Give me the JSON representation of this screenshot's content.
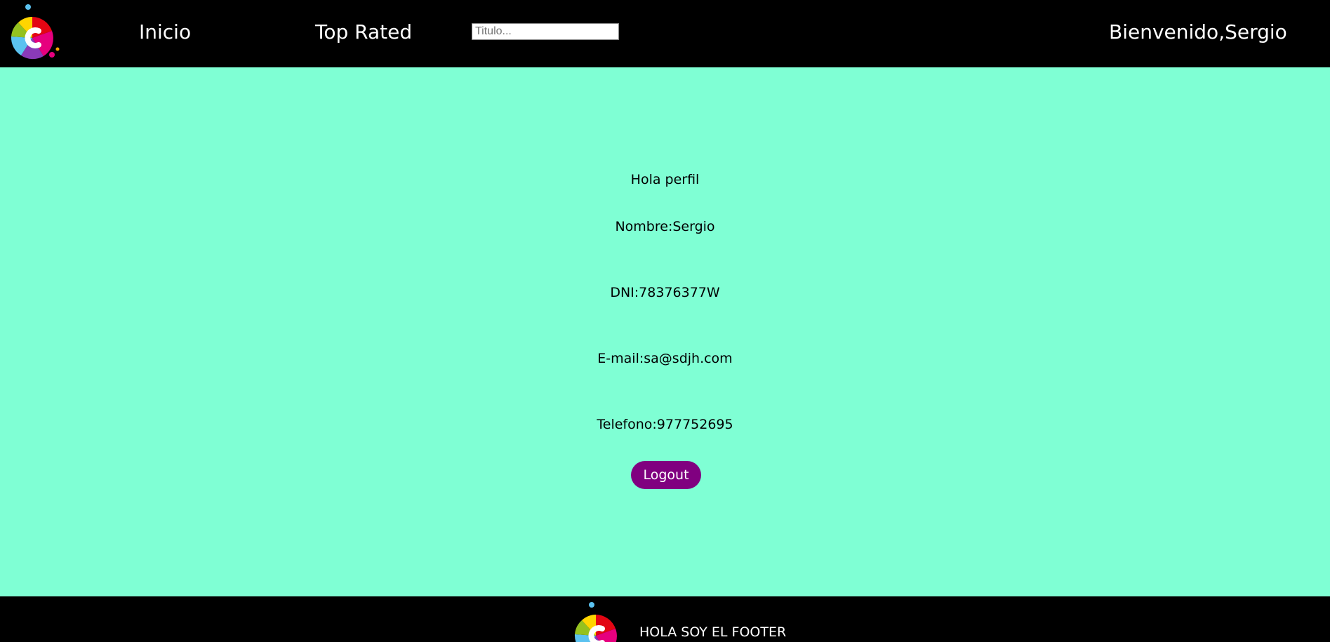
{
  "header": {
    "logo_icon": "colorful-c-logo-icon",
    "nav": {
      "inicio": "Inicio",
      "top_rated": "Top Rated"
    },
    "search": {
      "placeholder": "Titulo...",
      "value": ""
    },
    "welcome": "Bienvenido,Sergio"
  },
  "profile": {
    "greeting": "Hola perfil",
    "nombre": "Nombre:Sergio",
    "dni": "DNI:78376377W",
    "email": "E-mail:sa@sdjh.com",
    "telefono": "Telefono:977752695",
    "logout_label": "Logout"
  },
  "footer": {
    "logo_icon": "colorful-c-logo-icon",
    "text": "HOLA SOY EL FOOTER"
  },
  "colors": {
    "background": "#7fffd4",
    "header_bg": "#000000",
    "logout_bg": "#800080"
  }
}
